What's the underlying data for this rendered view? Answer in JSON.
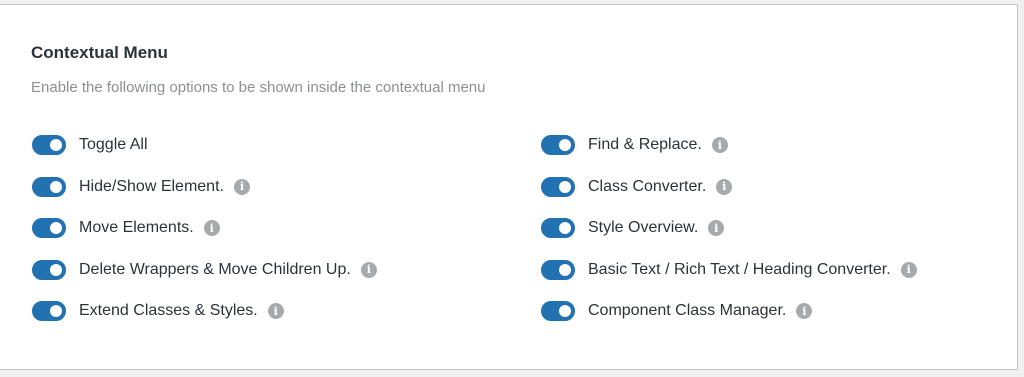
{
  "section": {
    "title": "Contextual Menu",
    "description": "Enable the following options to be shown inside the contextual menu"
  },
  "colors": {
    "toggle_on": "#2271b1",
    "info_icon": "#a7aaad",
    "text": "#2c3338",
    "muted_text": "#8c8f94"
  },
  "options_left": [
    {
      "label": "Toggle All",
      "enabled": true,
      "has_info": false
    },
    {
      "label": "Hide/Show Element.",
      "enabled": true,
      "has_info": true
    },
    {
      "label": "Move Elements.",
      "enabled": true,
      "has_info": true
    },
    {
      "label": "Delete Wrappers & Move Children Up.",
      "enabled": true,
      "has_info": true
    },
    {
      "label": "Extend Classes & Styles.",
      "enabled": true,
      "has_info": true
    }
  ],
  "options_right": [
    {
      "label": "Find & Replace.",
      "enabled": true,
      "has_info": true
    },
    {
      "label": "Class Converter.",
      "enabled": true,
      "has_info": true
    },
    {
      "label": "Style Overview.",
      "enabled": true,
      "has_info": true
    },
    {
      "label": "Basic Text / Rich Text / Heading Converter.",
      "enabled": true,
      "has_info": true
    },
    {
      "label": "Component Class Manager.",
      "enabled": true,
      "has_info": true
    }
  ],
  "info_icon_glyph": "i"
}
